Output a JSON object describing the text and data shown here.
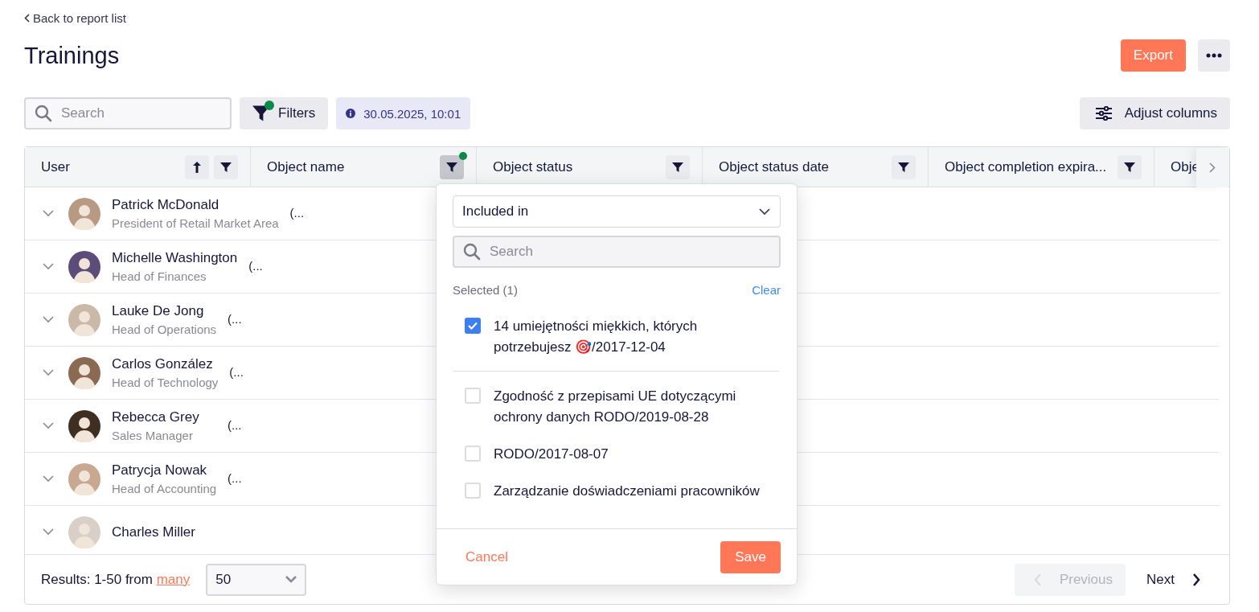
{
  "back_link": "Back to report list",
  "title": "Trainings",
  "export_button": "Export",
  "toolbar": {
    "search_placeholder": "Search",
    "filters_label": "Filters",
    "filters_active": true,
    "timestamp": "30.05.2025, 10:01",
    "adjust_columns": "Adjust columns"
  },
  "table": {
    "columns": [
      {
        "label": "User",
        "sorted": true,
        "filterable": true,
        "filter_active": false
      },
      {
        "label": "Object name",
        "sorted": false,
        "filterable": true,
        "filter_active": true
      },
      {
        "label": "Object status",
        "sorted": false,
        "filterable": true,
        "filter_active": false
      },
      {
        "label": "Object status date",
        "sorted": false,
        "filterable": true,
        "filter_active": false
      },
      {
        "label": "Object completion expira...",
        "sorted": false,
        "filterable": true,
        "filter_active": false
      },
      {
        "label": "Obje",
        "sorted": false
      }
    ],
    "rows": [
      {
        "name": "Patrick McDonald",
        "role": "President of Retail Market Area",
        "object_name": "(..."
      },
      {
        "name": "Michelle Washington",
        "role": "Head of Finances",
        "object_name": "(..."
      },
      {
        "name": "Lauke De Jong",
        "role": "Head of Operations",
        "object_name": "(..."
      },
      {
        "name": "Carlos González",
        "role": "Head of Technology",
        "object_name": "(..."
      },
      {
        "name": "Rebecca Grey",
        "role": "Sales Manager",
        "object_name": "(..."
      },
      {
        "name": "Patrycja Nowak",
        "role": "Head of Accounting",
        "object_name": "(..."
      },
      {
        "name": "Charles Miller",
        "role": "",
        "object_name": ""
      }
    ]
  },
  "filter_popover": {
    "condition": "Included in",
    "search_placeholder": "Search",
    "selected_label": "Selected (1)",
    "clear": "Clear",
    "selected_items": [
      {
        "label": "14 umiejętności miękkich, których potrzebujesz 🎯/2017-12-04",
        "checked": true
      }
    ],
    "items": [
      {
        "label": "Zgodność z przepisami UE dotyczącymi ochrony danych RODO/2019-08-28",
        "checked": false
      },
      {
        "label": "RODO/2017-08-07",
        "checked": false
      },
      {
        "label": "Zarządzanie doświadczeniami pracowników",
        "checked": false
      }
    ],
    "cancel": "Cancel",
    "save": "Save"
  },
  "footer": {
    "results": "Results: 1-50 from",
    "results_link": "many",
    "page_size": "50",
    "previous": "Previous",
    "previous_disabled": true,
    "next": "Next"
  }
}
